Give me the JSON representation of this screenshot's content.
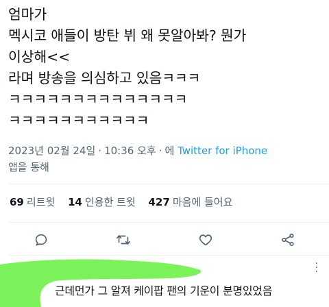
{
  "tweet": {
    "lines": [
      "엄마가",
      "멕시코 애들이 방탄 뷔 왜 못알아봐? 뭔가",
      "이상해<<",
      "라며 방송을 의심하고 있음ㅋㅋㅋ",
      "ㅋㅋㅋㅋㅋㅋㅋㅋㅋㅋㅋㅋㅋㅋ",
      "ㅋㅋㅋㅋㅋㅋㅋㅋㅋㅋㅋ"
    ],
    "date": "2023년 02월 24일",
    "time": "10:36 오후",
    "via_prefix": "에",
    "source": "Twitter for iPhone",
    "via_suffix": "앱을 통해"
  },
  "stats": {
    "retweets_count": "69",
    "retweets_label": "리트윗",
    "quotes_count": "14",
    "quotes_label": "인용한 트윗",
    "likes_count": "427",
    "likes_label": "마음에 들어요"
  },
  "actions": {
    "reply_icon": "reply-icon",
    "retweet_icon": "retweet-icon",
    "like_icon": "heart-icon",
    "share_icon": "share-icon"
  },
  "reply": {
    "text": "근데먼가 그 알져 케이팝 팬의 기운이 분명있었음"
  },
  "colors": {
    "text": "#0f1419",
    "muted": "#536471",
    "link": "#1d9bf0",
    "highlight": "#7cf25a"
  }
}
